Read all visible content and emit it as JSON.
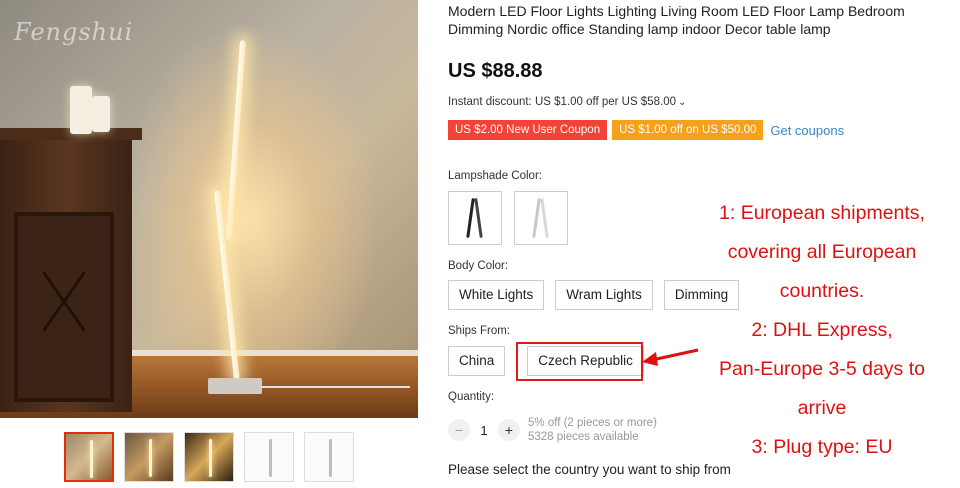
{
  "gallery": {
    "watermark": "Fengshui",
    "thumbnails": [
      "thumb-1",
      "thumb-2",
      "thumb-3",
      "thumb-4",
      "thumb-5"
    ],
    "active_index": 0
  },
  "product": {
    "title": "Modern LED Floor Lights Lighting Living Room LED Floor Lamp Bedroom Dimming Nordic office Standing lamp indoor Decor table lamp",
    "price": "US $88.88",
    "instant_discount": "Instant discount: US $1.00 off per US $58.00",
    "coupons": [
      {
        "label": "US $2.00 New User Coupon",
        "color": "#f44336"
      },
      {
        "label": "US $1.00 off on US $50.00",
        "color": "#f5a11a"
      }
    ],
    "get_coupons": "Get coupons"
  },
  "lampshade": {
    "label": "Lampshade Color:",
    "swatches": [
      "black-lamp",
      "silver-lamp"
    ]
  },
  "body_color": {
    "label": "Body Color:",
    "options": [
      "White Lights",
      "Wram Lights",
      "Dimming"
    ]
  },
  "ships_from": {
    "label": "Ships From:",
    "options": [
      "China",
      "Czech Republic"
    ],
    "highlighted": "Czech Republic"
  },
  "quantity": {
    "label": "Quantity:",
    "minus": "−",
    "plus": "+",
    "value": "1",
    "discount_note": "5% off (2 pieces or more)",
    "available": "5328 pieces available"
  },
  "ship_note": "Please select the country you want to ship from",
  "annotation": {
    "lines": [
      "1: European shipments,",
      "covering all European",
      "countries.",
      "2: DHL Express,",
      "Pan-Europe 3-5 days to",
      "arrive",
      "3: Plug type: EU"
    ],
    "color": "#e01010"
  }
}
